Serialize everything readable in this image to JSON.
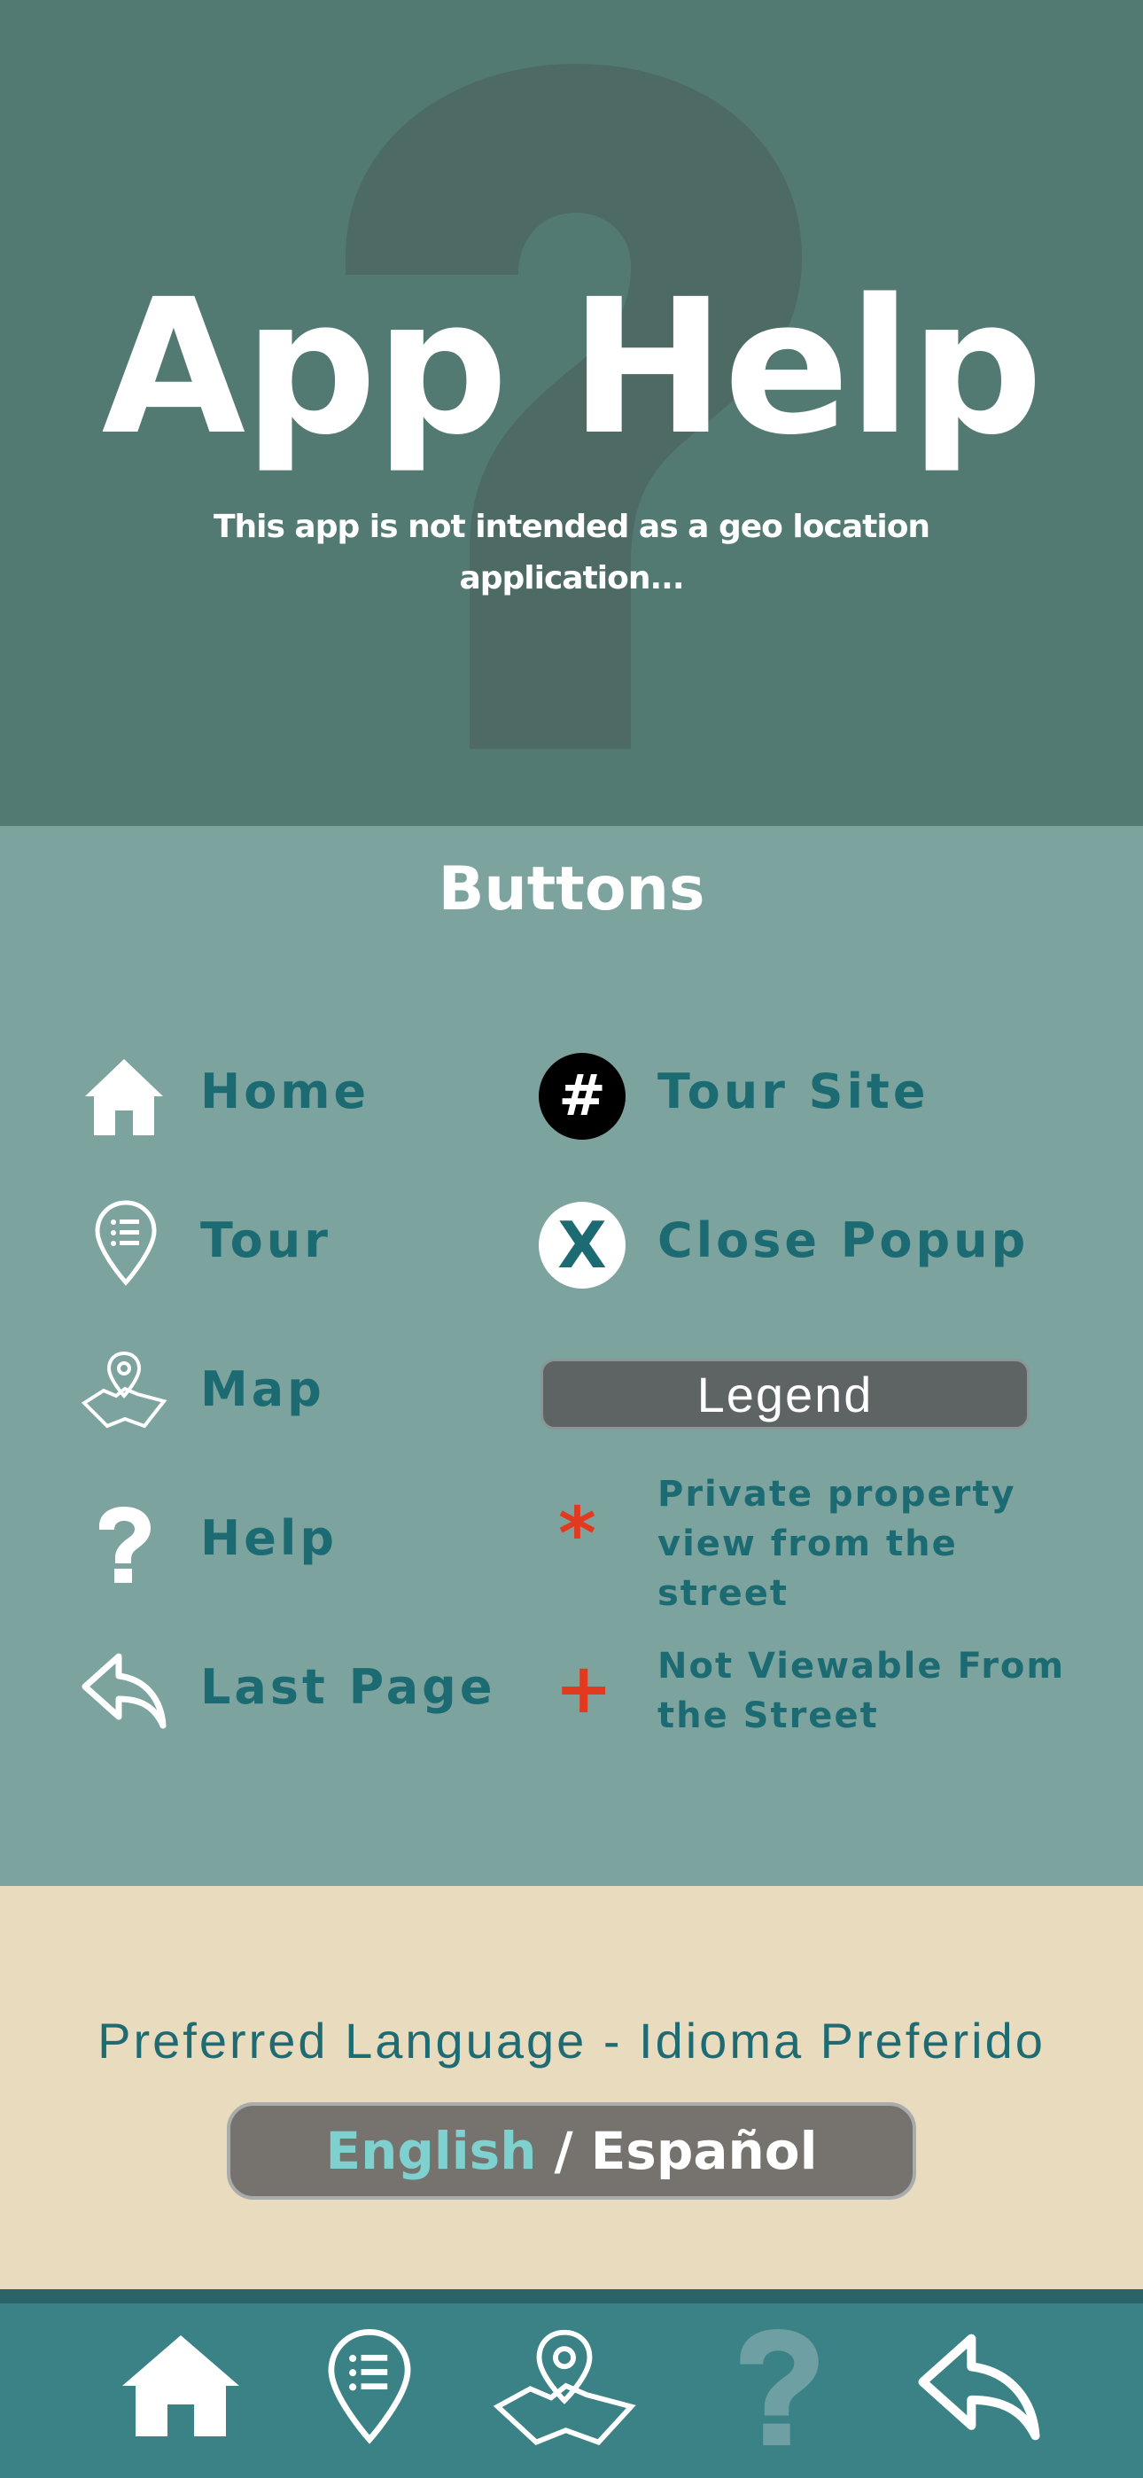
{
  "hero": {
    "title": "App Help",
    "subtitle": "This app is not intended as a geo location application..."
  },
  "buttons_section": {
    "title": "Buttons",
    "left_items": [
      {
        "label": "Home",
        "icon": "home-icon"
      },
      {
        "label": "Tour",
        "icon": "tour-list-pin-icon"
      },
      {
        "label": "Map",
        "icon": "map-pin-icon"
      },
      {
        "label": "Help",
        "icon": "question-icon"
      },
      {
        "label": "Last Page",
        "icon": "back-arrow-icon"
      }
    ],
    "right_items": [
      {
        "label": "Tour Site",
        "icon": "hash-circle-icon",
        "glyph": "#"
      },
      {
        "label": "Close Popup",
        "icon": "close-circle-icon",
        "glyph": "X"
      }
    ],
    "legend_label": "Legend",
    "legend_items": [
      {
        "mark": "*",
        "label": "Private property view from the street",
        "color": "#e23a1f"
      },
      {
        "mark": "+",
        "label": "Not Viewable From the Street",
        "color": "#e23a1f"
      }
    ]
  },
  "language": {
    "title": "Preferred Language - Idioma Preferido",
    "english": "English",
    "separator": "/",
    "spanish": "Español",
    "selected": "English"
  },
  "bottom_nav": {
    "items": [
      {
        "icon": "home-icon",
        "active": false
      },
      {
        "icon": "tour-list-pin-icon",
        "active": false
      },
      {
        "icon": "map-pin-icon",
        "active": false
      },
      {
        "icon": "question-icon",
        "active": true
      },
      {
        "icon": "back-arrow-icon",
        "active": false
      }
    ]
  },
  "colors": {
    "hero_bg": "#527a73",
    "buttons_bg": "#7da39f",
    "label_teal": "#1d6b72",
    "language_bg": "#e9dbbd",
    "nav_bg": "#3a8285",
    "accent_red": "#e23a1f",
    "english_highlight": "#7ed1cf"
  }
}
